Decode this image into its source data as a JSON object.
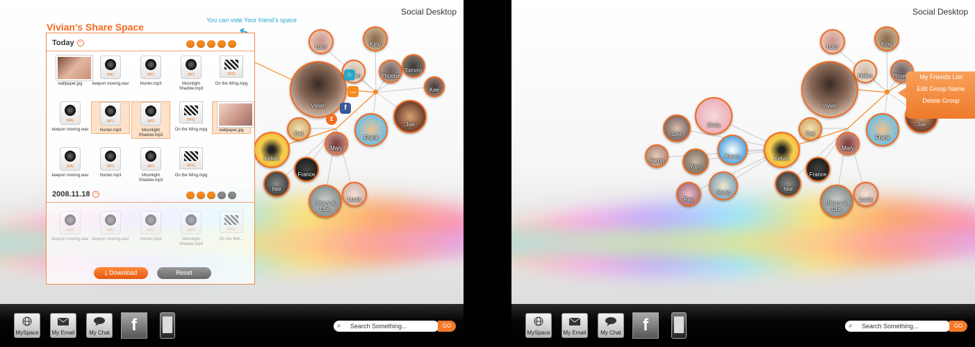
{
  "app_title": "Social Desktop",
  "share_space": {
    "title": "Vivian's Share Space",
    "vote_hint": "You can vote Your friend's space",
    "today_label": "Today",
    "date_label": "2008.11.18",
    "today_hearts": {
      "filled": 5,
      "total": 5
    },
    "date_hearts": {
      "filled": 3,
      "total": 5
    },
    "today_files": [
      {
        "name": "wallpaper.jpg",
        "kind": "photo",
        "tag": ""
      },
      {
        "name": "keepon moving.wav",
        "kind": "audio",
        "tag": "WAV"
      },
      {
        "name": "Hunter.mp3",
        "kind": "audio",
        "tag": "MP3"
      },
      {
        "name": "Moonlight Shadow.mp3",
        "kind": "audio",
        "tag": "MP3"
      },
      {
        "name": "On the Wing.mpg",
        "kind": "video",
        "tag": "MPG"
      },
      {
        "name": "keepon moving.wav",
        "kind": "audio",
        "tag": "WAV"
      },
      {
        "name": "Hunter.mp3",
        "kind": "audio",
        "tag": "MP3"
      },
      {
        "name": "Moonlight Shadow.mp3",
        "kind": "audio",
        "tag": "MP3"
      },
      {
        "name": "On the Wing.mpg",
        "kind": "video",
        "tag": "MPG"
      },
      {
        "name": "wallpaper.jpg",
        "kind": "photo",
        "tag": ""
      },
      {
        "name": "keepon moving.wav",
        "kind": "audio",
        "tag": "WAV"
      },
      {
        "name": "Hunter.mp3",
        "kind": "audio",
        "tag": "MP3"
      },
      {
        "name": "Moonlight Shadow.mp3",
        "kind": "audio",
        "tag": "MP3"
      },
      {
        "name": "On the Wing.mpg",
        "kind": "video",
        "tag": "MPG"
      }
    ],
    "date_files": [
      {
        "name": "keepon moving.wav",
        "kind": "audio",
        "tag": "WAV"
      },
      {
        "name": "keepon moving.wav",
        "kind": "audio",
        "tag": "WAV"
      },
      {
        "name": "Hunter.mp3",
        "kind": "audio",
        "tag": "MP3"
      },
      {
        "name": "Moonlight Shadow.mp3",
        "kind": "audio",
        "tag": "MP3"
      },
      {
        "name": "On the Win...",
        "kind": "video",
        "tag": "MPG"
      }
    ],
    "download_label": "Download",
    "reset_label": "Reset"
  },
  "friends": [
    "Vivian",
    "Lucy",
    "King",
    "Helen",
    "Phoebe",
    "Tommy",
    "Kee",
    "Joe",
    "Frank",
    "Mary",
    "Cat",
    "Kelvin",
    "France",
    "hee",
    "Jenny & Ube",
    "Louis"
  ],
  "friends_extra": [
    "Chris",
    "Leo",
    "Aaron",
    "Yoyo",
    "Karen",
    "Ray",
    "Mario"
  ],
  "context_menu": [
    "My Friends List",
    "Edit Group Name",
    "Delete Group"
  ],
  "taskbar": {
    "myspace": "MySpace",
    "email": "My Email",
    "chat": "My Chat",
    "facebook_icon": "f",
    "search_placeholder": "Search Something...",
    "go": "GO"
  },
  "colors": {
    "accent": "#f26a1e",
    "hint": "#29a7c9"
  }
}
